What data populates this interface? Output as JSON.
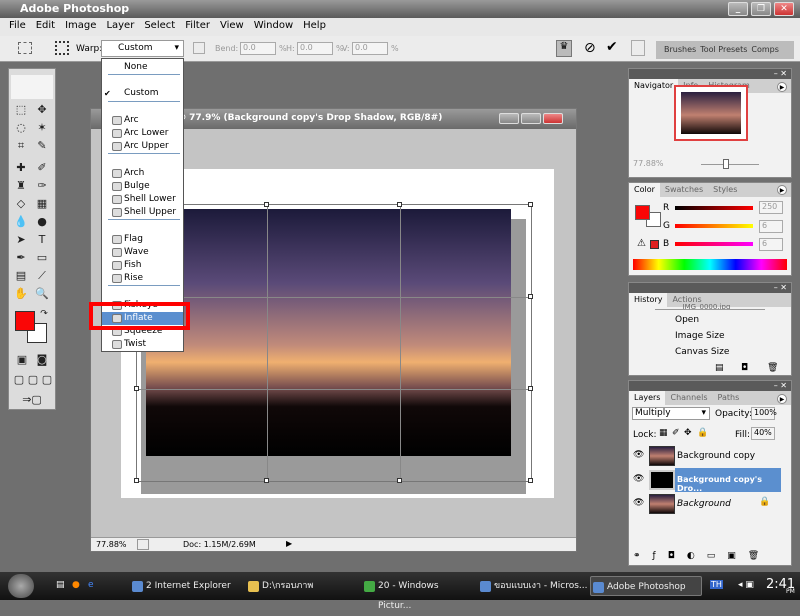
{
  "app": {
    "title": "Adobe Photoshop"
  },
  "menu": [
    "File",
    "Edit",
    "Image",
    "Layer",
    "Select",
    "Filter",
    "View",
    "Window",
    "Help"
  ],
  "options": {
    "warp_label": "Warp:",
    "warp_value": "Custom",
    "bend_label": "Bend:",
    "bend_value": "0.0",
    "h_label": "H:",
    "h_value": "0.0",
    "v_label": "V:",
    "v_value": "0.0",
    "pct": "%",
    "palette_tabs": [
      "Brushes",
      "Tool Presets",
      "Comps"
    ]
  },
  "warp_menu": {
    "items": [
      {
        "label": "None",
        "icon": "none"
      },
      {
        "label": "Custom",
        "icon": "check-icon",
        "checked": true
      },
      {
        "label": "Arc"
      },
      {
        "label": "Arc Lower"
      },
      {
        "label": "Arc Upper"
      },
      {
        "label": "Arch"
      },
      {
        "label": "Bulge"
      },
      {
        "label": "Shell Lower"
      },
      {
        "label": "Shell Upper"
      },
      {
        "label": "Flag"
      },
      {
        "label": "Wave"
      },
      {
        "label": "Fish"
      },
      {
        "label": "Rise"
      },
      {
        "label": "Fisheye"
      },
      {
        "label": "Inflate",
        "highlighted": true
      },
      {
        "label": "Squeeze"
      },
      {
        "label": "Twist"
      }
    ]
  },
  "document": {
    "title": "@ 77.9% (Background copy's Drop Shadow, RGB/8#)",
    "zoom": "77.88%",
    "doc_info": "Doc: 1.15M/2.69M"
  },
  "navigator": {
    "tabs": [
      "Navigator",
      "Info",
      "Histogram"
    ],
    "zoom": "77.88%"
  },
  "color": {
    "tabs": [
      "Color",
      "Swatches",
      "Styles"
    ],
    "r_label": "R",
    "g_label": "G",
    "b_label": "B",
    "r": "250",
    "g": "6",
    "b": "6",
    "foreground": "#fa0606",
    "background": "#ffffff"
  },
  "history": {
    "tabs": [
      "History",
      "Actions"
    ],
    "snapshot": "_IMG_0000.jpg",
    "items": [
      "Open",
      "Image Size",
      "Canvas Size"
    ]
  },
  "layers": {
    "tabs": [
      "Layers",
      "Channels",
      "Paths"
    ],
    "blend": "Multiply",
    "opacity_label": "Opacity:",
    "opacity": "100%",
    "lock_label": "Lock:",
    "fill_label": "Fill:",
    "fill": "40%",
    "items": [
      {
        "name": "Background copy"
      },
      {
        "name": "Background copy's Dro...",
        "selected": true
      },
      {
        "name": "Background",
        "locked": true
      }
    ]
  },
  "taskbar": {
    "items": [
      "2 Internet Explorer",
      "D:\\กรอบภาพ",
      "20 - Windows Pictur...",
      "ขอบแบบเงา - Micros...",
      "Adobe Photoshop"
    ],
    "lang": "TH",
    "time": "2:41",
    "ampm": "PM"
  },
  "colors": {
    "accent": "#5b8fcf",
    "highlight_box": "#ff0000"
  }
}
